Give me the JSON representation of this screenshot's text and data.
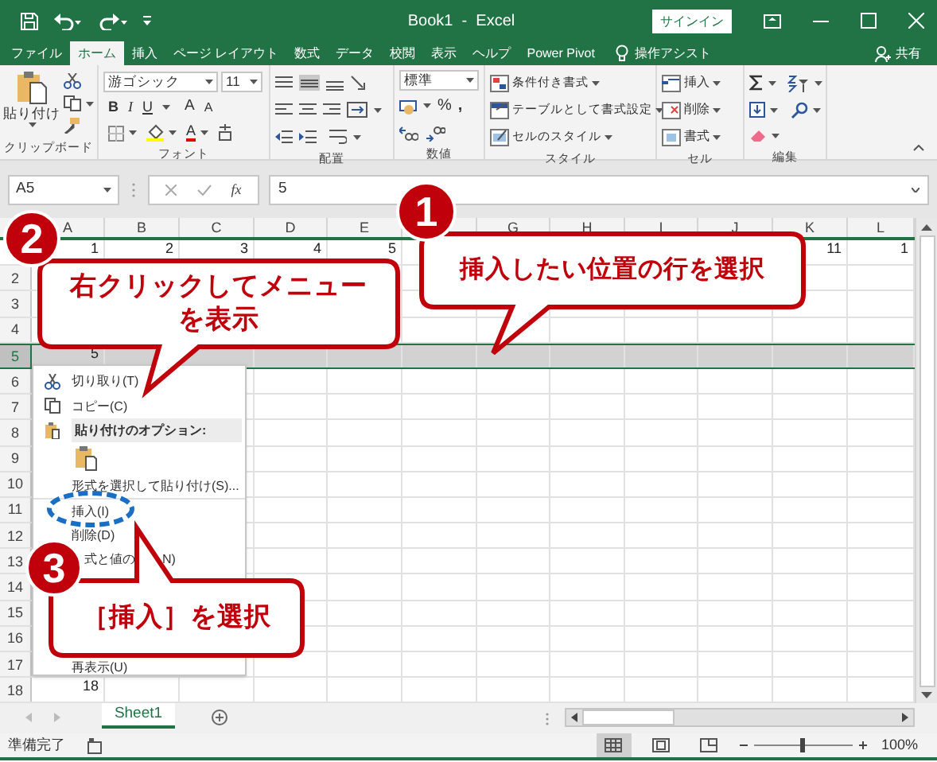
{
  "title_bar": {
    "title": "Book1  -  Excel",
    "sign_in": "サインイン"
  },
  "tabs": [
    {
      "label": "ファイル",
      "selected": false
    },
    {
      "label": "ホーム",
      "selected": true
    },
    {
      "label": "挿入",
      "selected": false
    },
    {
      "label": "ページ レイアウト",
      "selected": false
    },
    {
      "label": "数式",
      "selected": false
    },
    {
      "label": "データ",
      "selected": false
    },
    {
      "label": "校閲",
      "selected": false
    },
    {
      "label": "表示",
      "selected": false
    },
    {
      "label": "ヘルプ",
      "selected": false
    },
    {
      "label": "Power Pivot",
      "selected": false
    }
  ],
  "tell_me": "操作アシスト",
  "share": "共有",
  "ribbon": [
    {
      "kind": "clipboard",
      "label": "クリップボード",
      "paste": "貼り付け"
    },
    {
      "kind": "font",
      "label": "フォント",
      "font_name": "游ゴシック",
      "font_size": "11",
      "styles": [
        "B",
        "I",
        "U"
      ],
      "grow": "A",
      "shrink": "A",
      "font_color": "A"
    },
    {
      "kind": "alignment",
      "label": "配置"
    },
    {
      "kind": "number",
      "label": "数値",
      "format": "標準",
      "percent": "%",
      "comma": ","
    },
    {
      "kind": "styles",
      "label": "スタイル",
      "buttons": [
        "条件付き書式",
        "テーブルとして書式設定",
        "セルのスタイル"
      ]
    },
    {
      "kind": "cells",
      "label": "セル",
      "buttons": [
        "挿入",
        "削除",
        "書式"
      ]
    },
    {
      "kind": "editing",
      "label": "編集"
    }
  ],
  "formula_bar": {
    "name_box": "A5",
    "function_button": "fx",
    "formula": "5"
  },
  "columns": [
    "A",
    "B",
    "C",
    "D",
    "E",
    null,
    "G",
    "H",
    "I",
    "J",
    "K",
    "L"
  ],
  "rows": [
    {
      "selected": false,
      "cells": [
        "1",
        "2",
        "3",
        "4",
        "5",
        null,
        null,
        null,
        null,
        null,
        "11",
        "1"
      ]
    },
    {
      "header": "2",
      "selected": false
    },
    {
      "header": "3",
      "selected": false
    },
    {
      "header": "4",
      "selected": false
    },
    {
      "header": "5",
      "selected": true,
      "cells": [
        "5"
      ]
    },
    {
      "header": "6",
      "selected": false
    },
    {
      "header": "7",
      "selected": false
    },
    {
      "header": "8",
      "selected": false
    },
    {
      "header": "9",
      "selected": false
    },
    {
      "header": "10",
      "selected": false
    },
    {
      "header": "11",
      "selected": false
    },
    {
      "header": "12",
      "selected": false
    },
    {
      "header": "13",
      "selected": false
    },
    {
      "header": "14",
      "selected": false
    },
    {
      "header": "15",
      "selected": false
    },
    {
      "header": "16",
      "selected": false
    },
    {
      "header": "17",
      "selected": false
    },
    {
      "header": "18",
      "selected": false,
      "cells": [
        "18"
      ]
    }
  ],
  "context_menu": [
    {
      "kind": "cut",
      "label": "切り取り(T)"
    },
    {
      "kind": "copy",
      "label": "コピー(C)"
    },
    {
      "kind": "header",
      "label": "貼り付けのオプション:"
    },
    {
      "kind": "paste-options"
    },
    {
      "kind": "command",
      "label": "形式を選択して貼り付け(S)..."
    },
    {
      "kind": "command",
      "label": "挿入(I)",
      "separator": true
    },
    {
      "kind": "command",
      "label": "削除(D)"
    },
    {
      "kind": "command",
      "parts": [
        "式と値の",
        "N)"
      ]
    },
    {
      "kind": "spacer"
    },
    {
      "kind": "command",
      "label": "再表示(U)"
    }
  ],
  "sheet_tabs": [
    {
      "label": "Sheet1",
      "selected": true
    }
  ],
  "status_bar": {
    "status": "準備完了",
    "views": [
      {
        "kind": "normal",
        "selected": true
      },
      {
        "kind": "page-layout",
        "selected": false
      },
      {
        "kind": "page-break",
        "selected": false
      }
    ],
    "zoom_slider": {
      "level": 0.5
    },
    "zoom": "100%"
  },
  "callouts": [
    {
      "number": "1",
      "lines": [
        "挿入したい位置の行を選択"
      ]
    },
    {
      "number": "2",
      "lines": [
        "右クリックしてメニュー",
        "を表示"
      ]
    },
    {
      "number": "3",
      "lines": [
        "［挿入］を選択"
      ]
    }
  ]
}
